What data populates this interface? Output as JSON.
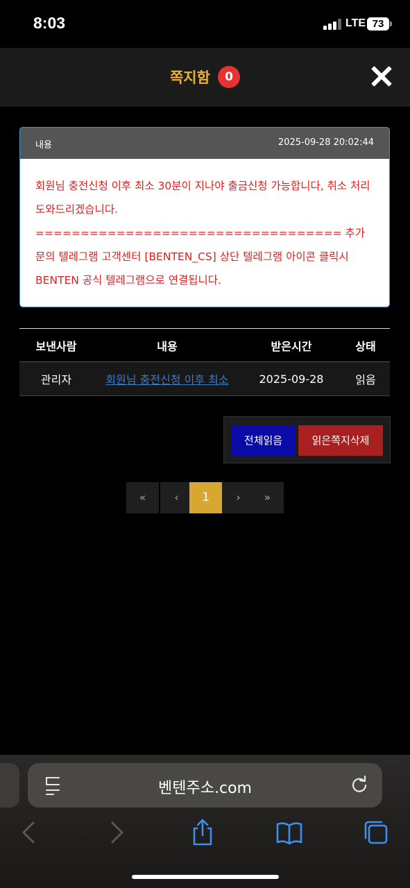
{
  "status_bar": {
    "time": "8:03",
    "network": "LTE",
    "battery": "73"
  },
  "modal": {
    "title": "쪽지함",
    "unread_count": "0"
  },
  "message_detail": {
    "label": "내용",
    "date": "2025-09-28 20:02:44",
    "lines": [
      "회원님 충전신청 이후 최소 30분이 지나야 출금신청 가능합니다, 취소 처리 도와드리겠습니다.",
      "================================== 추가 문의 텔레그램 고객센터 [BENTEN_CS] 상단 텔레그램 아이콘 클릭시 BENTEN 공식 텔레그램으로 연결됩니다."
    ]
  },
  "table": {
    "headers": [
      "보낸사람",
      "내용",
      "받은시간",
      "상태"
    ],
    "rows": [
      {
        "sender": "관리자",
        "content": "회원님 충전신청 이후 최소",
        "received": "2025-09-28",
        "status": "읽음"
      }
    ]
  },
  "actions": {
    "read_all": "전체읽음",
    "delete_read": "읽은쪽지삭제"
  },
  "pagination": {
    "first": "«",
    "prev": "‹",
    "current": "1",
    "next": "›",
    "last": "»"
  },
  "browser": {
    "url": "벤텐주소.com"
  },
  "colors": {
    "title_accent": "#f0b12a",
    "badge": "#e63232",
    "message_text": "#e02020",
    "read_all_bg": "#0a0aa6",
    "delete_bg": "#a82020",
    "active_page": "#d8a732",
    "link": "#3a7cc8"
  },
  "icons": [
    "reader-icon",
    "reload-icon",
    "back-icon",
    "forward-icon",
    "share-icon",
    "bookmarks-icon",
    "tabs-icon",
    "close-icon"
  ]
}
